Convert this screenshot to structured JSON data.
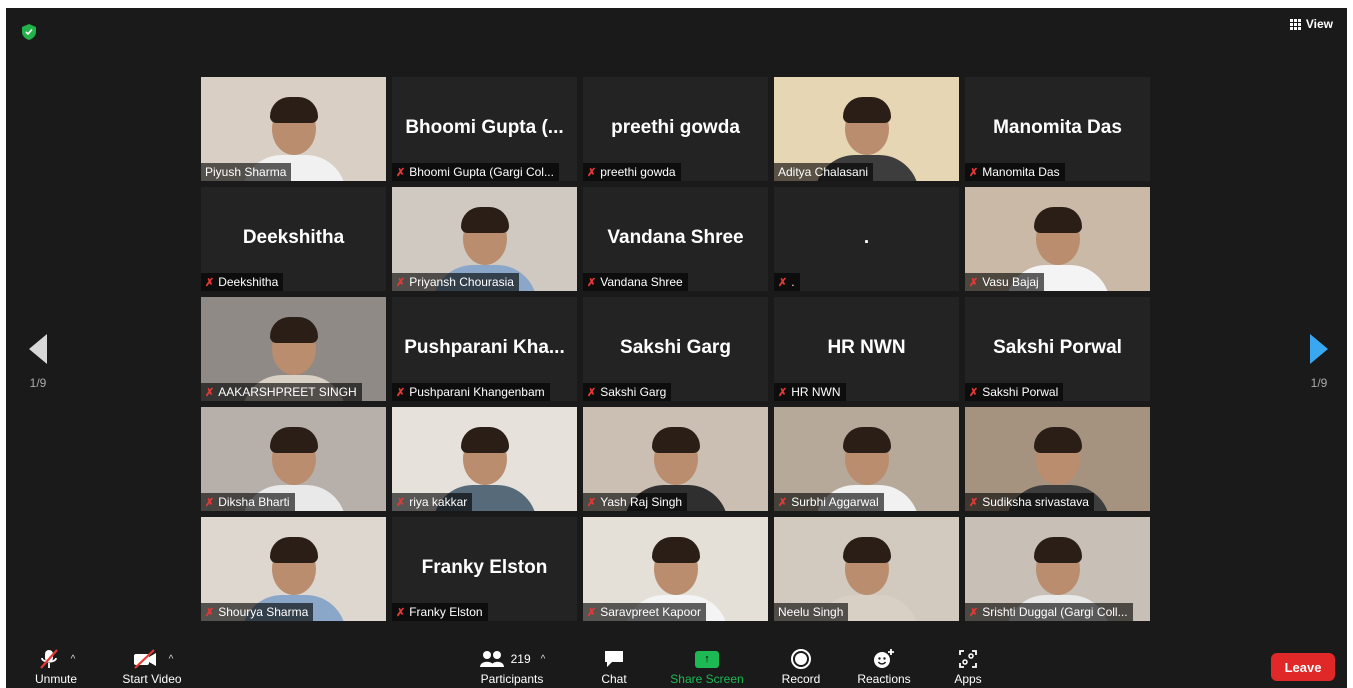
{
  "header": {
    "view_label": "View"
  },
  "colors": {
    "stage": "#1a1a1a",
    "active_speaker": "#e9e05a",
    "share_green": "#1db954",
    "leave_red": "#e02828",
    "page_arrow": "#3aa8f0"
  },
  "pagination": {
    "left": "1/9",
    "right": "1/9"
  },
  "tiles": [
    {
      "label": "Piyush Sharma",
      "video": true,
      "muted": false
    },
    {
      "label": "Bhoomi Gupta (Gargi Col...",
      "display": "Bhoomi  Gupta  (...",
      "video": false,
      "muted": true
    },
    {
      "label": "preethi gowda",
      "display": "preethi gowda",
      "video": false,
      "muted": true
    },
    {
      "label": "Aditya Chalasani",
      "video": true,
      "muted": false,
      "active": true
    },
    {
      "label": "Manomita Das",
      "display": "Manomita Das",
      "video": false,
      "muted": true
    },
    {
      "label": "Deekshitha",
      "display": "Deekshitha",
      "video": false,
      "muted": true
    },
    {
      "label": "Priyansh Chourasia",
      "video": true,
      "muted": true
    },
    {
      "label": "Vandana Shree",
      "display": "Vandana Shree",
      "video": false,
      "muted": true
    },
    {
      "label": ".",
      "display": ".",
      "video": false,
      "muted": true
    },
    {
      "label": "Vasu Bajaj",
      "video": true,
      "muted": true
    },
    {
      "label": "AAKARSHPREET SINGH",
      "video": true,
      "muted": true
    },
    {
      "label": "Pushparani Khangenbam",
      "display": "Pushparani  Kha...",
      "video": false,
      "muted": true
    },
    {
      "label": "Sakshi Garg",
      "display": "Sakshi Garg",
      "video": false,
      "muted": true
    },
    {
      "label": "HR NWN",
      "display": "HR NWN",
      "video": false,
      "muted": true
    },
    {
      "label": "Sakshi Porwal",
      "display": "Sakshi Porwal",
      "video": false,
      "muted": true
    },
    {
      "label": "Diksha Bharti",
      "video": true,
      "muted": true
    },
    {
      "label": "riya kakkar",
      "video": true,
      "muted": true
    },
    {
      "label": "Yash Raj Singh",
      "video": true,
      "muted": true
    },
    {
      "label": "Surbhi Aggarwal",
      "video": true,
      "muted": true
    },
    {
      "label": "Sudiksha srivastava",
      "video": true,
      "muted": true
    },
    {
      "label": "Shourya Sharma",
      "video": true,
      "muted": true
    },
    {
      "label": "Franky Elston",
      "display": "Franky Elston",
      "video": false,
      "muted": true
    },
    {
      "label": "Saravpreet Kapoor",
      "video": true,
      "muted": true
    },
    {
      "label": "Neelu Singh",
      "video": true,
      "muted": false
    },
    {
      "label": "Srishti Duggal (Gargi Coll...",
      "video": true,
      "muted": true
    }
  ],
  "toolbar": {
    "unmute": "Unmute",
    "start_video": "Start Video",
    "participants": "Participants",
    "participants_count": "219",
    "chat": "Chat",
    "share_screen": "Share Screen",
    "record": "Record",
    "reactions": "Reactions",
    "apps": "Apps",
    "leave": "Leave"
  }
}
